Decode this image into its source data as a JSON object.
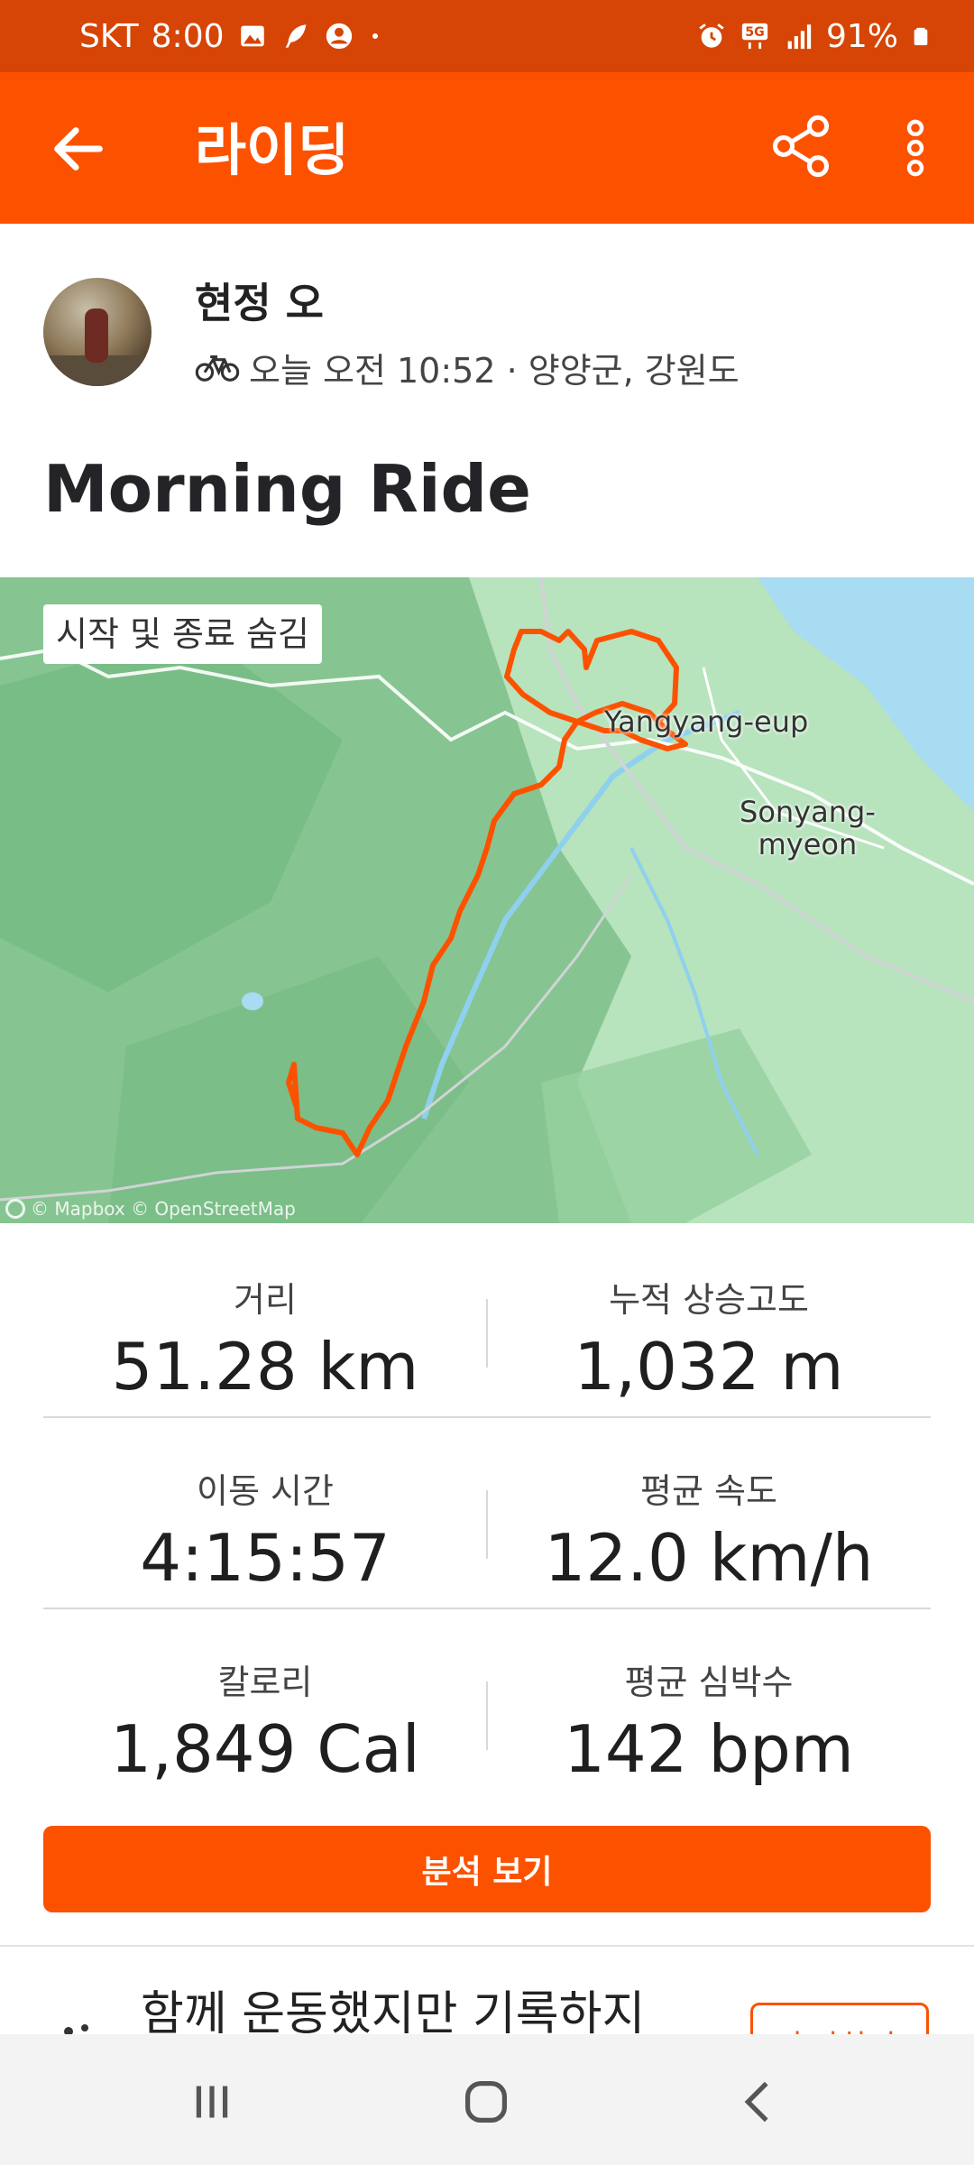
{
  "status_bar": {
    "carrier": "SKT",
    "time": "8:00",
    "network": "5G",
    "battery": "91%",
    "icons_left": [
      "gallery-icon",
      "feather-icon",
      "account-icon",
      "dot-icon"
    ],
    "icons_right": [
      "alarm-icon",
      "5g-icon",
      "signal-icon",
      "battery-icon"
    ]
  },
  "app_bar": {
    "title": "라이딩",
    "back_icon": "arrow-left-icon",
    "share_icon": "share-icon",
    "more_icon": "more-vertical-icon"
  },
  "athlete": {
    "name": "현정 오",
    "activity_meta": "오늘 오전 10:52 · 양양군, 강원도",
    "sport_icon": "bike-icon"
  },
  "activity": {
    "title": "Morning Ride"
  },
  "map": {
    "toggle_label": "시작 및 종료 숨김",
    "places": [
      "Yangyang-eup",
      "Sonyang-\nmyeon"
    ],
    "attribution": "© Mapbox © OpenStreetMap",
    "route_color": "#fc5200",
    "land_color": "#86c591",
    "water_color": "#a8dcf2"
  },
  "stats": [
    {
      "label": "거리",
      "value": "51.28 km"
    },
    {
      "label": "누적 상승고도",
      "value": "1,032 m"
    },
    {
      "label": "이동 시간",
      "value": "4:15:57"
    },
    {
      "label": "평균 속도",
      "value": "12.0 km/h"
    },
    {
      "label": "칼로리",
      "value": "1,849 Cal"
    },
    {
      "label": "평균 심박수",
      "value": "142 bpm"
    }
  ],
  "actions": {
    "analyze_label": "분석 보기",
    "together_text": "함께 운동했지만 기록하지",
    "add_label": "추가하기"
  },
  "colors": {
    "brand": "#fc5200",
    "status_bar": "#d64505"
  }
}
